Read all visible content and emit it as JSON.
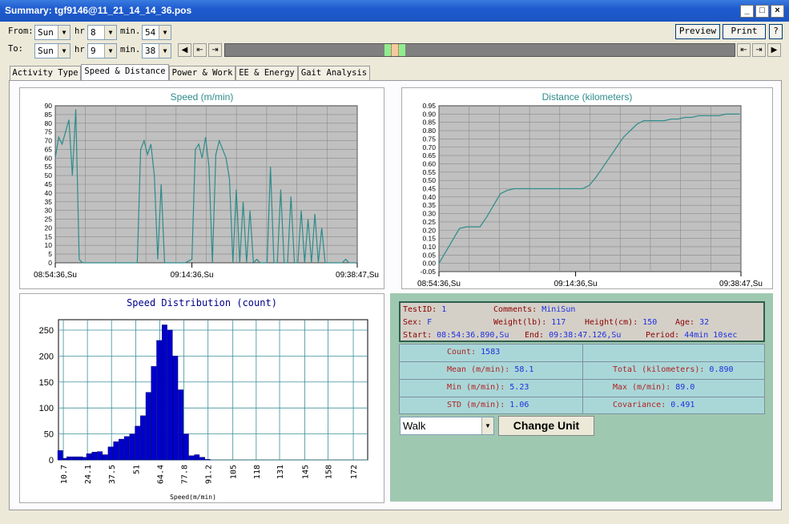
{
  "window": {
    "title": "Summary: tgf9146@11_21_14_14_36.pos"
  },
  "timeFilter": {
    "from_label": "From:",
    "to_label": "To:",
    "hr_label": "hr",
    "min_label": "min.",
    "from_day": "Sun",
    "from_hr": "8",
    "from_min": "54",
    "to_day": "Sun",
    "to_hr": "9",
    "to_min": "38"
  },
  "toolbar": {
    "preview_label": "Preview",
    "print_label": "Print",
    "help_label": "?"
  },
  "tabs": [
    {
      "label": "Activity Type",
      "active": false
    },
    {
      "label": "Speed & Distance",
      "active": true
    },
    {
      "label": "Power & Work",
      "active": false
    },
    {
      "label": "EE & Energy",
      "active": false
    },
    {
      "label": "Gait Analysis",
      "active": false
    }
  ],
  "chart_data": [
    {
      "type": "line",
      "title": "Speed (m/min)",
      "xlabel": "",
      "ylabel": "",
      "x_ticks": [
        "08:54:36,Su",
        "09:14:36,Su",
        "09:38:47,Su"
      ],
      "x_range_min": [
        0,
        44.2
      ],
      "ylim": [
        0,
        90
      ],
      "y_ticks": [
        0,
        5,
        10,
        15,
        20,
        25,
        30,
        35,
        40,
        45,
        50,
        55,
        60,
        65,
        70,
        75,
        80,
        85,
        90
      ],
      "grid": true,
      "color": "#2E8B8B",
      "x": [
        0,
        0.5,
        1,
        1.5,
        2,
        2.5,
        3,
        3.5,
        4,
        4.5,
        5,
        5.5,
        6,
        7,
        8,
        9,
        10,
        11,
        12,
        12.5,
        13,
        13.5,
        14,
        14.5,
        15,
        15.5,
        16,
        17,
        18,
        19,
        20,
        20.5,
        21,
        21.5,
        22,
        22.5,
        23,
        23.5,
        24,
        24.5,
        25,
        25.5,
        26,
        26.5,
        27,
        27.5,
        28,
        28.5,
        29,
        29.5,
        30,
        30.5,
        31,
        31.5,
        32,
        32.5,
        33,
        33.5,
        34,
        34.5,
        35,
        35.5,
        36,
        36.5,
        37,
        37.5,
        38,
        38.5,
        39,
        39.5,
        40,
        40.5,
        41,
        41.5,
        42,
        42.5,
        43,
        43.5,
        44
      ],
      "y": [
        60,
        72,
        68,
        75,
        82,
        50,
        88,
        2,
        0,
        0,
        0,
        0,
        0,
        0,
        0,
        0,
        0,
        0,
        0,
        65,
        70,
        62,
        68,
        50,
        2,
        45,
        0,
        0,
        0,
        0,
        2,
        65,
        68,
        60,
        72,
        55,
        0,
        62,
        70,
        65,
        60,
        48,
        0,
        42,
        0,
        35,
        0,
        30,
        0,
        2,
        0,
        0,
        0,
        55,
        0,
        0,
        42,
        0,
        0,
        38,
        0,
        0,
        30,
        0,
        25,
        0,
        28,
        0,
        20,
        0,
        0,
        0,
        0,
        0,
        0,
        2,
        0,
        0,
        0
      ],
      "series": [
        {
          "values": []
        }
      ]
    },
    {
      "type": "line",
      "title": "Distance (kilometers)",
      "xlabel": "",
      "ylabel": "",
      "x_ticks": [
        "08:54:36,Su",
        "09:14:36,Su",
        "09:38:47,Su"
      ],
      "x_range_min": [
        0,
        44.2
      ],
      "ylim": [
        -0.05,
        0.95
      ],
      "y_ticks": [
        -0.05,
        0,
        0.05,
        0.1,
        0.15,
        0.2,
        0.25,
        0.3,
        0.35,
        0.4,
        0.45,
        0.5,
        0.55,
        0.6,
        0.65,
        0.7,
        0.75,
        0.8,
        0.85,
        0.9,
        0.95
      ],
      "grid": true,
      "color": "#2E8B8B",
      "x": [
        0,
        1,
        2,
        3,
        4,
        5,
        6,
        7,
        8,
        9,
        10,
        11,
        12,
        13,
        14,
        15,
        16,
        17,
        18,
        19,
        20,
        21,
        22,
        23,
        24,
        25,
        26,
        27,
        28,
        29,
        30,
        31,
        32,
        33,
        34,
        35,
        36,
        37,
        38,
        39,
        40,
        41,
        42,
        43,
        44
      ],
      "y": [
        0,
        0.07,
        0.14,
        0.21,
        0.22,
        0.22,
        0.22,
        0.28,
        0.35,
        0.42,
        0.44,
        0.45,
        0.45,
        0.45,
        0.45,
        0.45,
        0.45,
        0.45,
        0.45,
        0.45,
        0.45,
        0.45,
        0.47,
        0.52,
        0.58,
        0.64,
        0.7,
        0.76,
        0.8,
        0.84,
        0.86,
        0.86,
        0.86,
        0.86,
        0.87,
        0.87,
        0.88,
        0.88,
        0.89,
        0.89,
        0.89,
        0.89,
        0.9,
        0.9,
        0.9
      ]
    },
    {
      "type": "bar",
      "title": "Speed Distribution (count)",
      "xlabel": "Speed(m/min)",
      "ylabel": "",
      "x_ticks": [
        "10.7",
        "24.1",
        "37.5",
        "51",
        "64.4",
        "77.8",
        "91.2",
        "105",
        "118",
        "131",
        "145",
        "158",
        "172"
      ],
      "xlim": [
        8,
        180
      ],
      "ylim": [
        0,
        270
      ],
      "y_ticks": [
        0,
        50,
        100,
        150,
        200,
        250
      ],
      "color": "#0000CD",
      "bin_width": 2.8,
      "bins": [
        9,
        12,
        14,
        17,
        20,
        22,
        25,
        28,
        31,
        34,
        37,
        40,
        43,
        46,
        49,
        52,
        55,
        58,
        61,
        64,
        67,
        70,
        73,
        76,
        79,
        82,
        85,
        88,
        91
      ],
      "values": [
        18,
        3,
        6,
        6,
        6,
        5,
        12,
        15,
        16,
        10,
        25,
        35,
        40,
        45,
        50,
        65,
        85,
        130,
        180,
        230,
        260,
        250,
        200,
        135,
        50,
        8,
        10,
        5,
        1
      ]
    }
  ],
  "summary": {
    "testid_label": "TestID:",
    "testid": "1",
    "comments_label": "Comments:",
    "comments": "MiniSun",
    "sex_label": "Sex:",
    "sex": "F",
    "weight_label": "Weight(lb):",
    "weight": "117",
    "height_label": "Height(cm):",
    "height": "150",
    "age_label": "Age:",
    "age": "32",
    "start_label": "Start:",
    "start": "08:54:36.890,Su",
    "end_label": "End:",
    "end": "09:38:47.126,Su",
    "period_label": "Period:",
    "period": "44min 10sec"
  },
  "stats": {
    "count_label": "Count:",
    "count": "1583",
    "mean_label": "Mean (m/min):",
    "mean": "58.1",
    "total_label": "Total (kilometers):",
    "total": "0.890",
    "min_label": "Min (m/min):",
    "min": "5.23",
    "max_label": "Max (m/min):",
    "max": "89.0",
    "std_label": "STD (m/min):",
    "std": "1.06",
    "cov_label": "Covariance:",
    "cov": "0.491"
  },
  "controls": {
    "activity_selected": "Walk",
    "change_unit_label": "Change Unit"
  }
}
